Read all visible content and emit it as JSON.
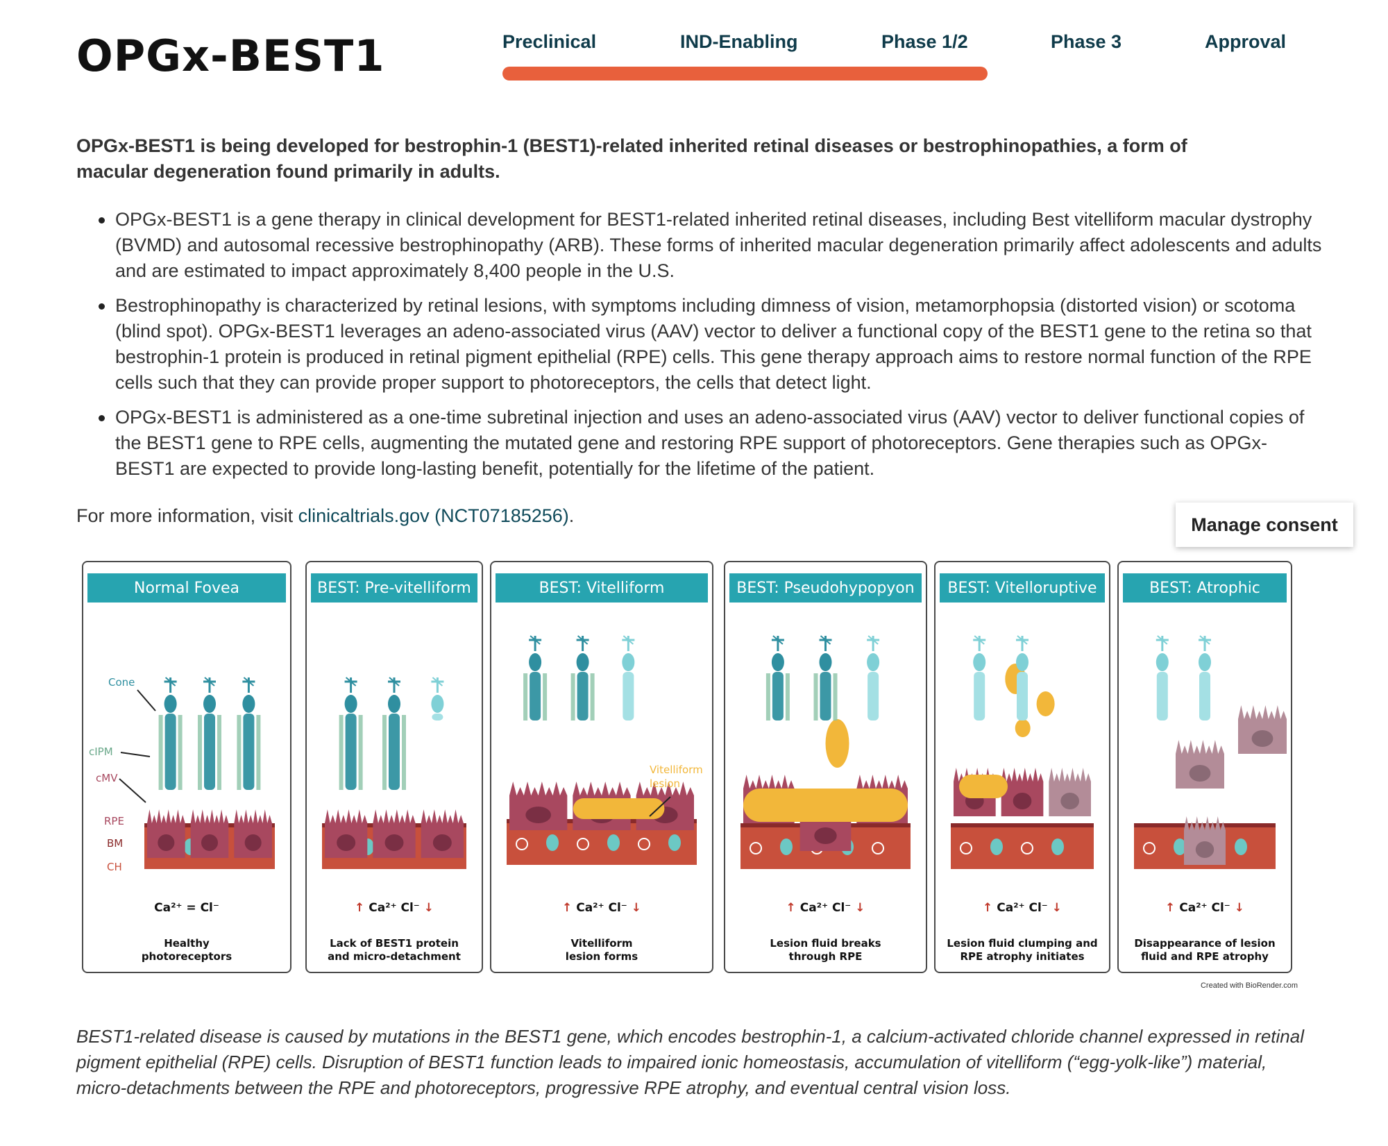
{
  "page": {
    "title": "OPGx-BEST1"
  },
  "pipeline": {
    "stages": [
      "Preclinical",
      "IND-Enabling",
      "Phase 1/2",
      "Phase 3",
      "Approval"
    ],
    "current_stage": "Phase 1/2",
    "progress_stage_count": 3,
    "accent_color": "#e8603c"
  },
  "intro": "OPGx-BEST1 is being developed for bestrophin-1 (BEST1)-related inherited retinal diseases or bestrophinopathies, a form of macular degeneration found primarily in adults.",
  "bullets": [
    "OPGx-BEST1 is a gene therapy in clinical development for BEST1-related inherited retinal diseases, including Best vitelliform macular dystrophy (BVMD) and autosomal recessive bestrophinopathy (ARB). These forms of inherited macular degeneration primarily affect adolescents and adults and are estimated to impact approximately 8,400 people in the U.S.",
    "Bestrophinopathy is characterized by retinal lesions, with symptoms including dimness of vision, metamorphopsia (distorted vision) or scotoma (blind spot). OPGx-BEST1 leverages an adeno-associated virus (AAV) vector to deliver a functional copy of the BEST1 gene to the retina so that bestrophin-1 protein is produced in retinal pigment epithelial (RPE) cells. This gene therapy approach aims to restore normal function of the RPE cells such that they can provide proper support to photoreceptors, the cells that detect light.",
    "OPGx-BEST1 is administered as a one-time subretinal injection and uses an adeno-associated virus (AAV) vector to deliver functional copies of the BEST1 gene to RPE cells, augmenting the mutated gene and restoring RPE support of photoreceptors. Gene therapies such as OPGx-BEST1 are expected to provide long-lasting benefit, potentially for the lifetime of the patient."
  ],
  "more_info": {
    "prefix": "For more information, visit",
    "link_text": "clinicaltrials.gov (NCT07185256)",
    "suffix": "."
  },
  "consent_button": "Manage consent",
  "figure": {
    "panels": [
      {
        "title": "Normal Fovea",
        "ions": "Ca²⁺ = Cl⁻",
        "caption": [
          "Healthy",
          "photoreceptors"
        ]
      },
      {
        "title": "BEST: Pre-vitelliform",
        "ions": "Ca²⁺  Cl⁻",
        "caption": [
          "Lack of BEST1 protein",
          "and micro-detachment"
        ]
      },
      {
        "title": "BEST: Vitelliform",
        "ions": "Ca²⁺  Cl⁻",
        "caption": [
          "Vitelliform",
          "lesion forms"
        ]
      },
      {
        "title": "BEST: Pseudohypopyon",
        "ions": "Ca²⁺  Cl⁻",
        "caption": [
          "Lesion fluid breaks",
          "through RPE"
        ]
      },
      {
        "title": "BEST: Vitelloruptive",
        "ions": "Ca²⁺  Cl⁻",
        "caption": [
          "Lesion fluid clumping and",
          "RPE atrophy initiates"
        ]
      },
      {
        "title": "BEST: Atrophic",
        "ions": "Ca²⁺  Cl⁻",
        "caption": [
          "Disappearance of lesion",
          "fluid and RPE atrophy"
        ]
      }
    ],
    "layer_labels": {
      "cone": "Cone",
      "cipm": "cIPM",
      "cmv": "cMV",
      "rpe": "RPE",
      "bm": "BM",
      "ch": "CH"
    },
    "lesion_label": [
      "Vitelliform",
      "lesion"
    ],
    "credit": "Created with BioRender.com",
    "colors": {
      "header": "#27a4b0",
      "rpe": "#a8485f",
      "choroid": "#c8503c",
      "lesion": "#f2b73a",
      "cone": "#2f8fa0"
    }
  },
  "bottom_caption": "BEST1-related disease is caused by mutations in the BEST1 gene, which encodes bestrophin-1, a calcium-activated chloride channel expressed in retinal pigment epithelial (RPE) cells. Disruption of BEST1 function leads to impaired ionic homeostasis, accumulation of vitelliform (“egg-yolk-like”) material, micro-detachments between the RPE and photoreceptors, progressive RPE atrophy, and eventual central vision loss."
}
